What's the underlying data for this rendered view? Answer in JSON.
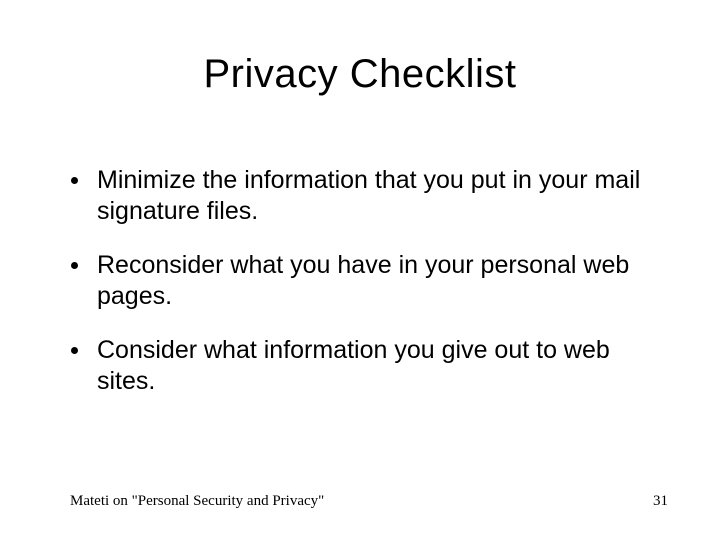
{
  "title": "Privacy Checklist",
  "bullets": [
    "Minimize the information that you put in your mail signature files.",
    "Reconsider what you have in your personal web pages.",
    "Consider what information you give out to web sites."
  ],
  "footer": {
    "left": "Mateti on \"Personal Security and Privacy\"",
    "page": "31"
  }
}
